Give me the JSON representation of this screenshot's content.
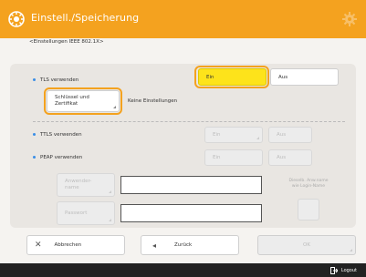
{
  "header": {
    "title": "Einstell./Speicherung",
    "app_icon": "settings-icon",
    "gear_icon": "gear-icon"
  },
  "breadcrumb": "<Einstellungen IEEE 802.1X>",
  "tls": {
    "label": "TLS verwenden",
    "on_label": "Ein",
    "off_label": "Aus"
  },
  "key_cert": {
    "button_label_line1": "Schlüssel und",
    "button_label_line2": "Zertifikat",
    "status": "Keine Einstellungen"
  },
  "ttls": {
    "label": "TTLS verwenden",
    "on_label": "Ein",
    "off_label": "Aus"
  },
  "peap": {
    "label": "PEAP verwenden",
    "on_label": "Ein",
    "off_label": "Aus"
  },
  "login": {
    "user_button_line1": "Anwender-",
    "user_button_line2": "name",
    "password_button": "Passwort",
    "user_value": "",
    "password_value": "",
    "note_line1": "Dieselb. Anw.name",
    "note_line2": "wie Login-Name"
  },
  "bottom": {
    "cancel_label": "Abbrechen",
    "back_label": "Zurück",
    "ok_label": "OK"
  },
  "footer": {
    "logout_label": "Logout"
  },
  "colors": {
    "accent": "#f4a21f",
    "selected": "#fde31b",
    "footer": "#222222"
  }
}
